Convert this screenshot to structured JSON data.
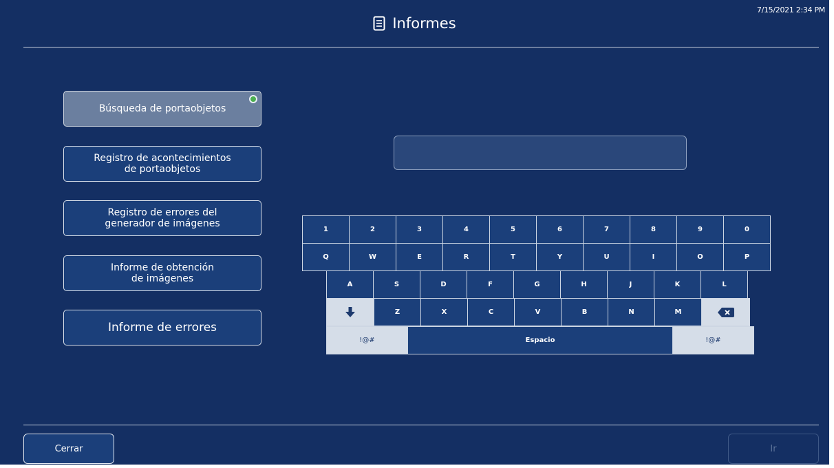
{
  "header": {
    "datetime": "7/15/2021 2:34 PM",
    "title": "Informes",
    "title_icon": "document-icon"
  },
  "menu": {
    "items": [
      {
        "label": "Búsqueda de portaobjetos",
        "selected": true
      },
      {
        "label": "Registro de acontecimientos\nde portaobjetos"
      },
      {
        "label": "Registro de errores del\ngenerador de imágenes"
      },
      {
        "label": "Informe de obtención\nde imágenes"
      },
      {
        "label": "Informe de errores"
      }
    ]
  },
  "search": {
    "value": "",
    "placeholder": ""
  },
  "keyboard": {
    "row1": [
      "1",
      "2",
      "3",
      "4",
      "5",
      "6",
      "7",
      "8",
      "9",
      "0"
    ],
    "row2": [
      "Q",
      "W",
      "E",
      "R",
      "T",
      "Y",
      "U",
      "I",
      "O",
      "P"
    ],
    "row3": [
      "A",
      "S",
      "D",
      "F",
      "G",
      "H",
      "J",
      "K",
      "L"
    ],
    "row4": [
      "Z",
      "X",
      "C",
      "V",
      "B",
      "N",
      "M"
    ],
    "symbols_label": "!@#",
    "space_label": "Espacio",
    "shift_icon": "arrow-down-icon",
    "backspace_icon": "backspace-icon"
  },
  "footer": {
    "close_label": "Cerrar",
    "go_label": "Ir"
  },
  "colors": {
    "background": "#142f63",
    "button": "#1b3f7a",
    "selected_button": "#6b7f9f",
    "status_dot": "#4caf50",
    "light_key": "#d5dde8"
  }
}
